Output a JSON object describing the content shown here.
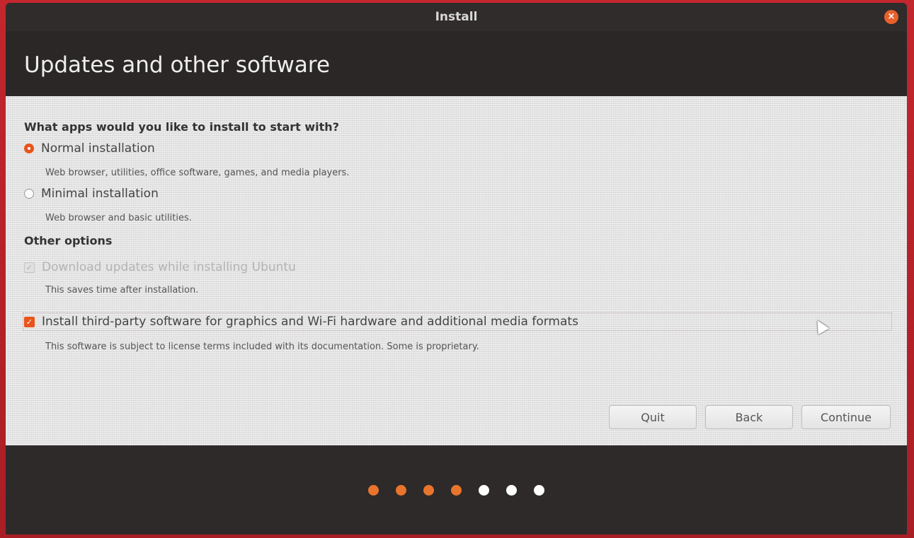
{
  "window": {
    "title": "Install",
    "close_symbol": "×"
  },
  "header": {
    "page_title": "Updates and other software"
  },
  "apps_section": {
    "heading": "What apps would you like to install to start with?",
    "options": [
      {
        "label": "Normal installation",
        "description": "Web browser, utilities, office software, games, and media players.",
        "selected": true
      },
      {
        "label": "Minimal installation",
        "description": "Web browser and basic utilities.",
        "selected": false
      }
    ]
  },
  "other_section": {
    "heading": "Other options",
    "download_updates": {
      "label": "Download updates while installing Ubuntu",
      "description": "This saves time after installation.",
      "checked": true,
      "enabled": false
    },
    "third_party": {
      "label": "Install third-party software for graphics and Wi-Fi hardware and additional media formats",
      "description": "This software is subject to license terms included with its documentation. Some is proprietary.",
      "checked": true,
      "enabled": true
    }
  },
  "buttons": {
    "quit": "Quit",
    "back": "Back",
    "continue": "Continue"
  },
  "progress": {
    "total_steps": 7,
    "completed_steps": 4
  },
  "colors": {
    "accent": "#e9541c",
    "progress_done": "#e9742c",
    "progress_todo": "#ffffff"
  },
  "icons": {
    "close": "close-icon",
    "check": "checkmark-icon",
    "pointer": "mouse-pointer-icon"
  }
}
